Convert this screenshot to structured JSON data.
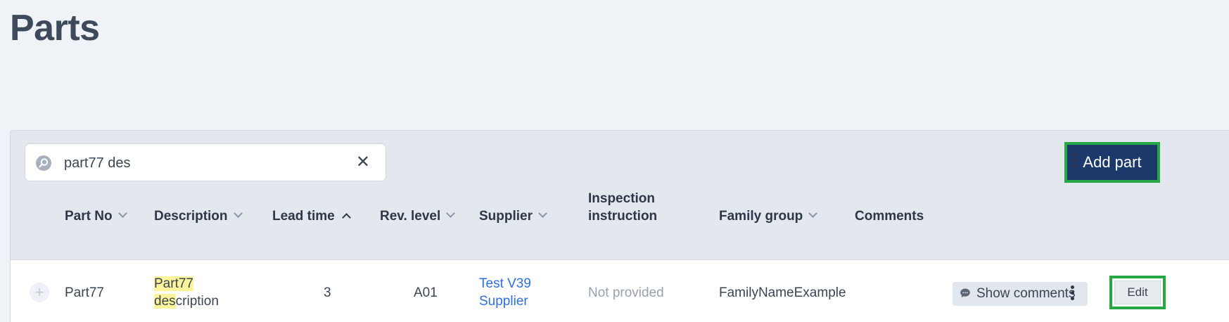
{
  "page": {
    "title": "Parts"
  },
  "toolbar": {
    "search_value": "part77 des",
    "add_label": "Add part"
  },
  "table": {
    "columns": {
      "part_no": "Part No",
      "description": "Description",
      "lead_time": "Lead time",
      "rev_level": "Rev. level",
      "supplier": "Supplier",
      "inspection_line1": "Inspection",
      "inspection_line2": "instruction",
      "family_group": "Family group",
      "comments": "Comments"
    },
    "rows": [
      {
        "part_no": "Part77",
        "description_hl1": "Part77",
        "description_hl2": "des",
        "description_rest": "cription",
        "lead_time": "3",
        "rev_level": "A01",
        "supplier_line1": "Test V39",
        "supplier_line2": "Supplier",
        "inspection": "Not provided",
        "family_group": "FamilyNameExample",
        "comments_label": "Show comments",
        "edit_label": "Edit"
      }
    ]
  },
  "colors": {
    "background": "#eff2f7",
    "panel": "#e3e8ef",
    "primary": "#1b3a6b",
    "highlight_border": "#28a745",
    "search_highlight": "#fdf39a",
    "link": "#2f6fde"
  },
  "icons": [
    "search-icon",
    "close-icon",
    "more-vertical-icon",
    "chevron-down-icon",
    "chevron-up-icon",
    "plus-icon",
    "comment-icon"
  ]
}
